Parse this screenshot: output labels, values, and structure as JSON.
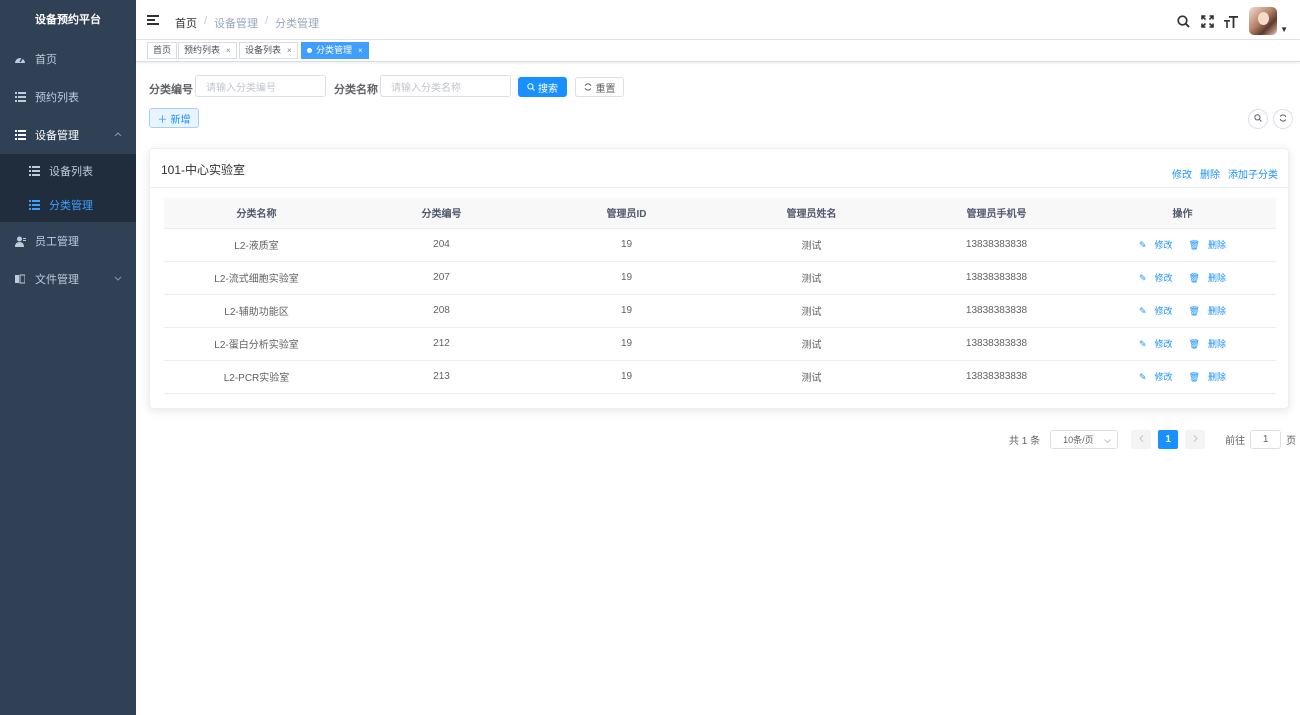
{
  "app": {
    "title": "设备预约平台"
  },
  "sidebar": {
    "items": [
      {
        "label": "首页",
        "icon": "dashboard-icon"
      },
      {
        "label": "预约列表",
        "icon": "list-icon"
      },
      {
        "label": "设备管理",
        "icon": "list-icon",
        "expanded": true,
        "children": [
          {
            "label": "设备列表",
            "icon": "list-icon"
          },
          {
            "label": "分类管理",
            "icon": "list-icon",
            "active": true
          }
        ]
      },
      {
        "label": "员工管理",
        "icon": "user-icon"
      },
      {
        "label": "文件管理",
        "icon": "document-icon",
        "expanded": false
      }
    ]
  },
  "breadcrumb": {
    "home": "首页",
    "level1": "设备管理",
    "level2": "分类管理"
  },
  "tags": [
    {
      "label": "首页"
    },
    {
      "label": "预约列表",
      "closable": true
    },
    {
      "label": "设备列表",
      "closable": true
    },
    {
      "label": "分类管理",
      "closable": true,
      "active": true
    }
  ],
  "tag_close": "×",
  "search": {
    "code_label": "分类编号",
    "code_placeholder": "请输入分类编号",
    "name_label": "分类名称",
    "name_placeholder": "请输入分类名称",
    "search_button": "搜索",
    "reset_button": "重置"
  },
  "toolbar": {
    "add_button": "新增"
  },
  "card": {
    "title": "101-中心实验室",
    "actions": {
      "edit": "修改",
      "delete": "删除",
      "add_child": "添加子分类"
    }
  },
  "table": {
    "columns": [
      "分类名称",
      "分类编号",
      "管理员ID",
      "管理员姓名",
      "管理员手机号",
      "操作"
    ],
    "row_actions": {
      "edit": "修改",
      "delete": "删除"
    },
    "rows": [
      [
        "L2-液质室",
        "204",
        "19",
        "测试",
        "13838383838"
      ],
      [
        "L2-流式细胞实验室",
        "207",
        "19",
        "测试",
        "13838383838"
      ],
      [
        "L2-辅助功能区",
        "208",
        "19",
        "测试",
        "13838383838"
      ],
      [
        "L2-蛋白分析实验室",
        "212",
        "19",
        "测试",
        "13838383838"
      ],
      [
        "L2-PCR实验室",
        "213",
        "19",
        "测试",
        "13838383838"
      ]
    ]
  },
  "pagination": {
    "total": "共 1 条",
    "page_size": "10条/页",
    "current_page": "1",
    "goto_prefix": "前往",
    "goto_value": "1",
    "goto_suffix": "页"
  },
  "colors": {
    "sidebar_bg": "#304156",
    "accent": "#1890ff",
    "submenu_bg": "#1f2d3d"
  }
}
